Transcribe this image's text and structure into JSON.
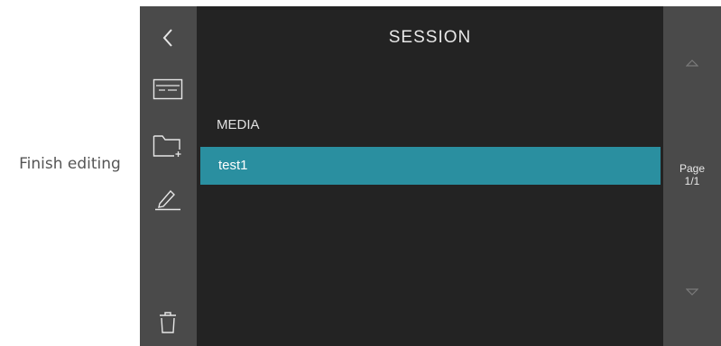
{
  "hint": {
    "text": "Finish editing"
  },
  "header": {
    "title": "SESSION"
  },
  "list": {
    "section_label": "MEDIA",
    "items": [
      {
        "label": "test1",
        "selected": true
      }
    ]
  },
  "pager": {
    "label": "Page",
    "position": "1/1"
  },
  "icons": {
    "back": "chevron-left-icon",
    "session": "session-card-icon",
    "new_folder": "folder-add-icon",
    "edit": "pencil-icon",
    "delete": "trash-icon",
    "page_up": "triangle-up-icon",
    "page_down": "triangle-down-icon"
  },
  "colors": {
    "sidebar": "#4a4a4a",
    "panel": "#232323",
    "accent": "#2a8fa0"
  }
}
